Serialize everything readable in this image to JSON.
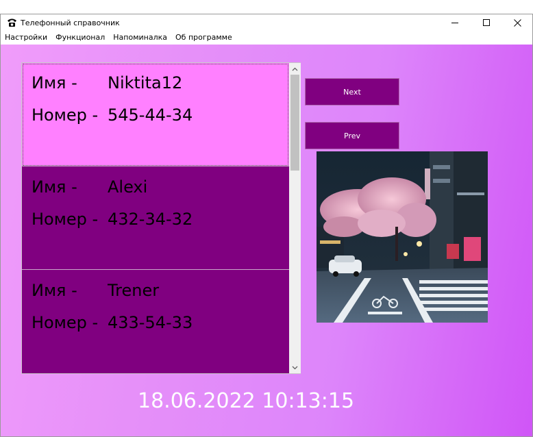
{
  "window": {
    "title": "Телефонный справочник",
    "icon": "telephone-icon"
  },
  "menu": {
    "items": [
      {
        "label": "Настройки"
      },
      {
        "label": "Функционал"
      },
      {
        "label": "Напоминалка"
      },
      {
        "label": "Об программе"
      }
    ]
  },
  "contacts": [
    {
      "name_label": "Имя -",
      "name": "Niktita12",
      "phone_label": "Номер -",
      "phone": "545-44-34",
      "selected": true
    },
    {
      "name_label": "Имя -",
      "name": "Alexi",
      "phone_label": "Номер -",
      "phone": "432-34-32",
      "selected": false
    },
    {
      "name_label": "Имя -",
      "name": "Trener",
      "phone_label": "Номер -",
      "phone": "433-54-33",
      "selected": false
    }
  ],
  "buttons": {
    "next": "Next",
    "prev": "Prev"
  },
  "photo": {
    "description_icon": "city-street-photo"
  },
  "clock": {
    "datetime": "18.06.2022 10:13:15"
  },
  "colors": {
    "card_bg": "#800080",
    "card_selected_bg": "#ff80ff",
    "button_bg": "#800080",
    "gradient_start": "#f09cfa",
    "gradient_end": "#d055f7"
  }
}
